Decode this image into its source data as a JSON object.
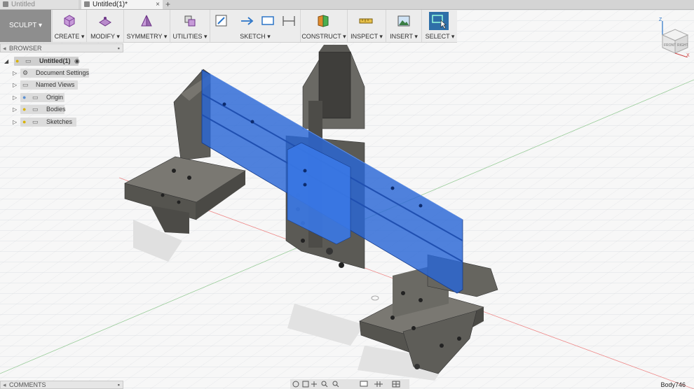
{
  "tabs": [
    {
      "label": "Untitled"
    },
    {
      "label": "Untitled(1)*"
    }
  ],
  "toolbar": {
    "workspace": "SCULPT ▾",
    "groups": [
      {
        "label": "CREATE ▾",
        "icon": "create-box-icon"
      },
      {
        "label": "MODIFY ▾",
        "icon": "modify-icon"
      },
      {
        "label": "SYMMETRY ▾",
        "icon": "symmetry-icon"
      },
      {
        "label": "UTILITIES ▾",
        "icon": "utilities-icon"
      },
      {
        "label": "SKETCH ▾",
        "icon": "sketch-icons"
      },
      {
        "label": "CONSTRUCT ▾",
        "icon": "construct-plane-icon"
      },
      {
        "label": "INSPECT ▾",
        "icon": "measure-icon"
      },
      {
        "label": "INSERT ▾",
        "icon": "insert-image-icon"
      },
      {
        "label": "SELECT ▾",
        "icon": "select-window-icon"
      }
    ]
  },
  "browser": {
    "title": "BROWSER",
    "root": "Untitled(1)",
    "items": [
      {
        "label": "Document Settings",
        "icon": "gear-icon"
      },
      {
        "label": "Named Views",
        "icon": "folder-icon"
      },
      {
        "label": "Origin",
        "icon": "folder-icon"
      },
      {
        "label": "Bodies",
        "icon": "folder-icon"
      },
      {
        "label": "Sketches",
        "icon": "folder-icon"
      }
    ]
  },
  "comments": {
    "title": "COMMENTS"
  },
  "status": {
    "selection_label": "Body746"
  },
  "viewcube": {
    "front": "FRONT",
    "right": "RIGHT",
    "axis_z": "Z",
    "axis_x": "X"
  },
  "colors": {
    "selection_blue": "#2a66d6",
    "model_grey": "#5b5a55",
    "grid": "#cfd3d8"
  }
}
